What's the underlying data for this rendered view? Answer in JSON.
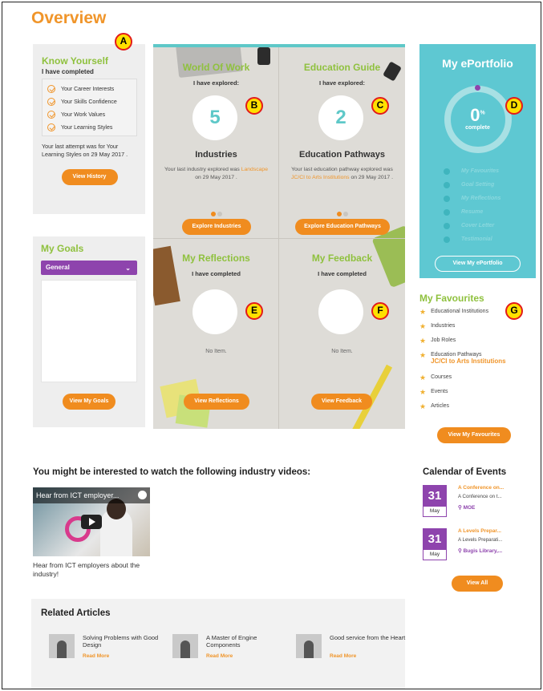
{
  "page_title": "Overview",
  "know_yourself": {
    "title": "Know Yourself",
    "subtitle": "I have completed",
    "items": [
      "Your Career Interests",
      "Your Skills Confidence",
      "Your Work Values",
      "Your Learning Styles"
    ],
    "last_attempt": "Your last attempt was for Your Learning Styles on 29 May 2017 .",
    "button": "View History"
  },
  "my_goals": {
    "title": "My Goals",
    "select_value": "General",
    "button": "View My Goals"
  },
  "world_of_work": {
    "title": "World Of Work",
    "explored_label": "I have explored:",
    "count": "5",
    "category": "Industries",
    "desc_prefix": "Your last industry explored was",
    "desc_highlight": "Landscape",
    "desc_suffix": "on 29 May 2017 .",
    "button": "Explore Industries"
  },
  "education_guide": {
    "title": "Education Guide",
    "explored_label": "I have explored:",
    "count": "2",
    "category": "Education Pathways",
    "desc_prefix": "Your last education pathway explored was",
    "desc_highlight": "JC/CI to Arts Institutions",
    "desc_suffix": "on 29 May 2017 .",
    "button": "Explore Education Pathways"
  },
  "my_reflections": {
    "title": "My Reflections",
    "completed_label": "I have completed",
    "empty": "No Item.",
    "button": "View Reflections"
  },
  "my_feedback": {
    "title": "My Feedback",
    "completed_label": "I have completed",
    "empty": "No Item.",
    "button": "View Feedback"
  },
  "eportfolio": {
    "title": "My ePortfolio",
    "percent": "0",
    "percent_sign": "%",
    "complete_label": "complete",
    "items": [
      "My Favourites",
      "Goal Setting",
      "My Reflections",
      "Resume",
      "Cover Letter",
      "Testimonial"
    ],
    "button": "View My ePortfolio"
  },
  "favourites": {
    "title": "My Favourites",
    "items": [
      {
        "label": "Educational Institutions",
        "link": ""
      },
      {
        "label": "Industries",
        "link": ""
      },
      {
        "label": "Job Roles",
        "link": ""
      },
      {
        "label": "Education Pathways",
        "link": "JC/CI to Arts Institutions"
      },
      {
        "label": "Courses",
        "link": ""
      },
      {
        "label": "Events",
        "link": ""
      },
      {
        "label": "Articles",
        "link": ""
      }
    ],
    "button": "View My Favourites"
  },
  "videos": {
    "heading": "You might be interested to watch the following industry videos:",
    "video_title": "Hear from ICT employer...",
    "caption": "Hear from ICT employers about the industry!"
  },
  "calendar": {
    "title": "Calendar of Events",
    "events": [
      {
        "day": "31",
        "month": "May",
        "title": "A Conference on...",
        "subtitle": "A Conference on t...",
        "location": "MOE"
      },
      {
        "day": "31",
        "month": "May",
        "title": "A Levels Prepar...",
        "subtitle": "A Levels Preparati...",
        "location": "Bugis Library,..."
      }
    ],
    "button": "View All"
  },
  "related_articles": {
    "title": "Related Articles",
    "items": [
      {
        "title": "Solving Problems with Good Design",
        "read_more": "Read More"
      },
      {
        "title": "A Master of Engine Components",
        "read_more": "Read More"
      },
      {
        "title": "Good service from the Heart",
        "read_more": "Read More"
      }
    ]
  },
  "badges": [
    "A",
    "B",
    "C",
    "D",
    "E",
    "F",
    "G"
  ],
  "colors": {
    "accent_orange": "#f08c1f",
    "title_green": "#8fc13e",
    "teal": "#5ec8d2",
    "purple": "#8e44ad"
  }
}
